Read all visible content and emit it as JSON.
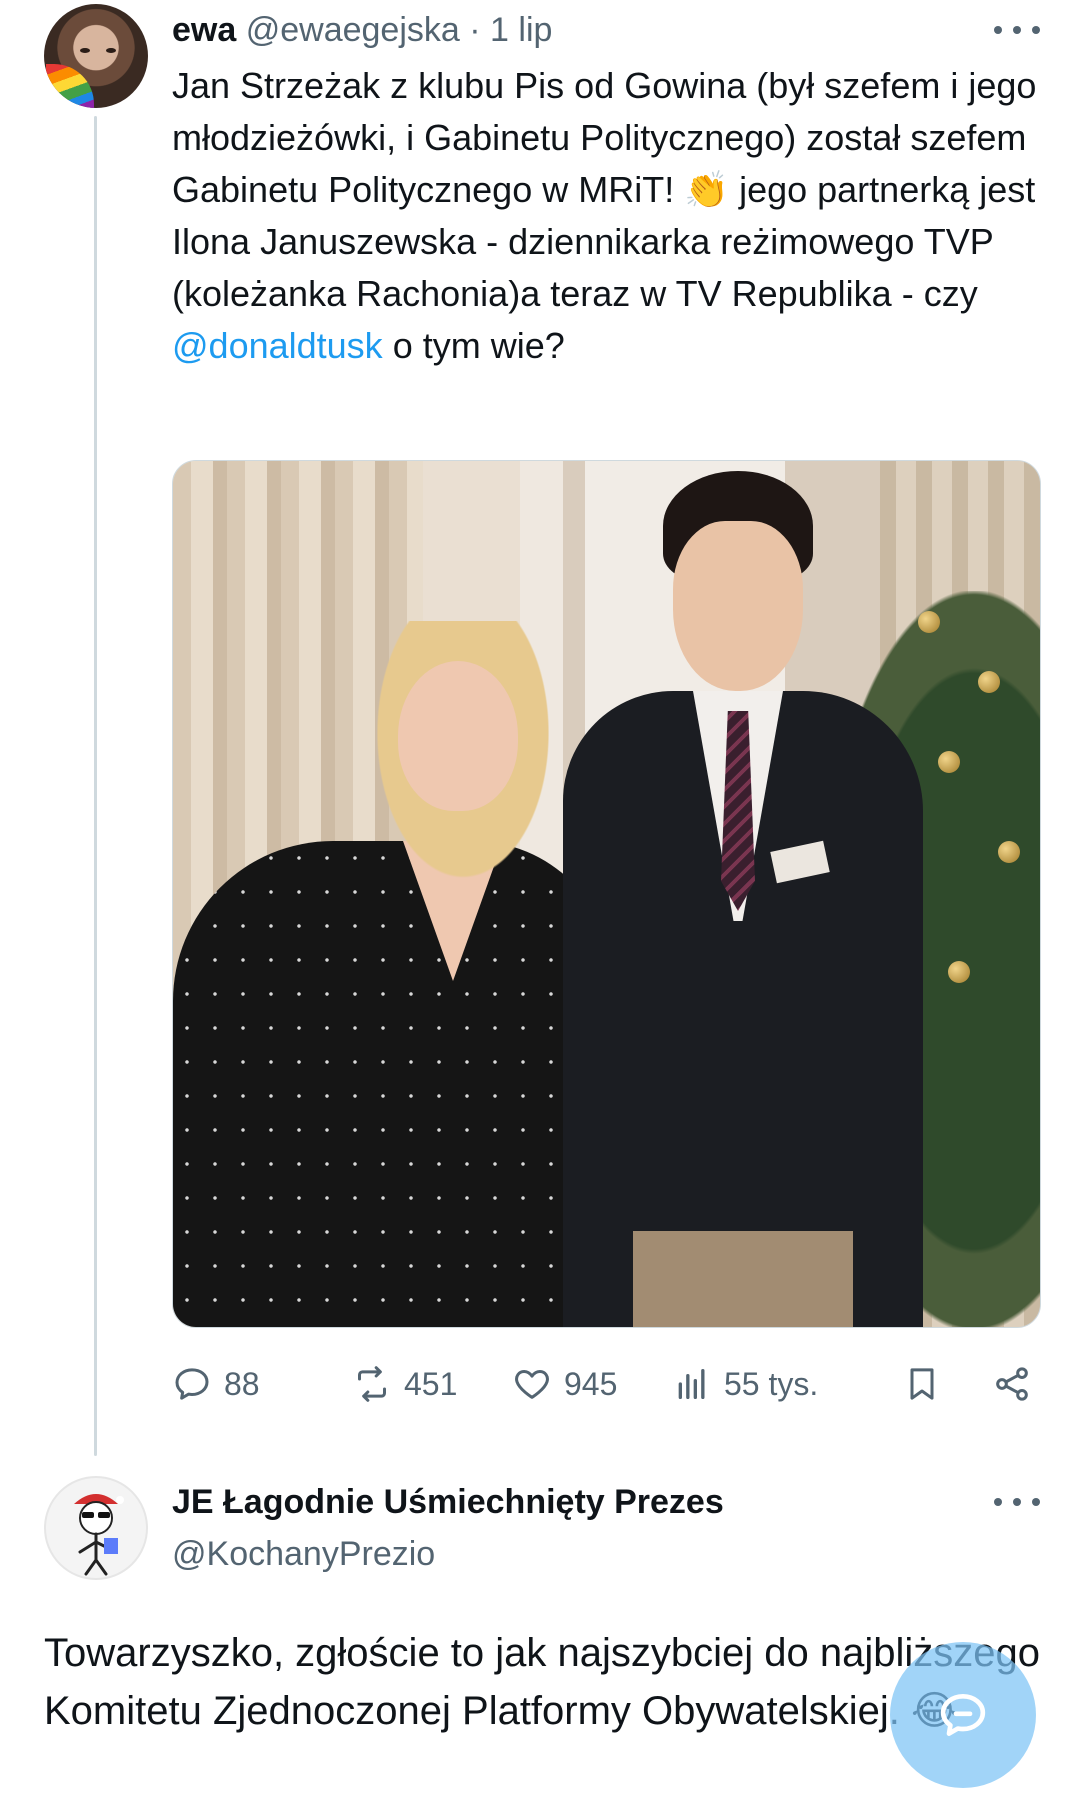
{
  "tweet": {
    "name": "ewa",
    "handle": "@ewaegejska",
    "separator": "·",
    "date": "1 lip",
    "text_before": "Jan Strzeżak z klubu Pis od Gowina (był szefem i jego młodzieżówki, i Gabinetu Politycznego) został szefem Gabinetu Politycznego w MRiT!",
    "emoji_clap": "👏",
    "text_middle": "jego partnerką jest Ilona Januszewska - dziennikarka reżimowego TVP (koleżanka Rachonia)a teraz w TV Republika - czy",
    "mention": "@donaldtusk",
    "text_after": "o tym wie?",
    "stats": {
      "replies": "88",
      "reposts": "451",
      "likes": "945",
      "views": "55 tys."
    }
  },
  "reply": {
    "name": "JE Łagodnie Uśmiechnięty Prezes",
    "handle": "@KochanyPrezio",
    "text": "Towarzyszko, zgłoście to jak najszybciej do najbliższego Komitetu Zjednoczonej Platformy Obywatelskiej.",
    "emoji": "😂"
  },
  "colors": {
    "accent": "#1d9bf0",
    "secondary_text": "#536471",
    "fab": "#7dc4f5"
  },
  "icons": [
    "more-icon",
    "reply-icon",
    "repost-icon",
    "like-icon",
    "views-icon",
    "bookmark-icon",
    "share-icon",
    "compose-icon"
  ]
}
